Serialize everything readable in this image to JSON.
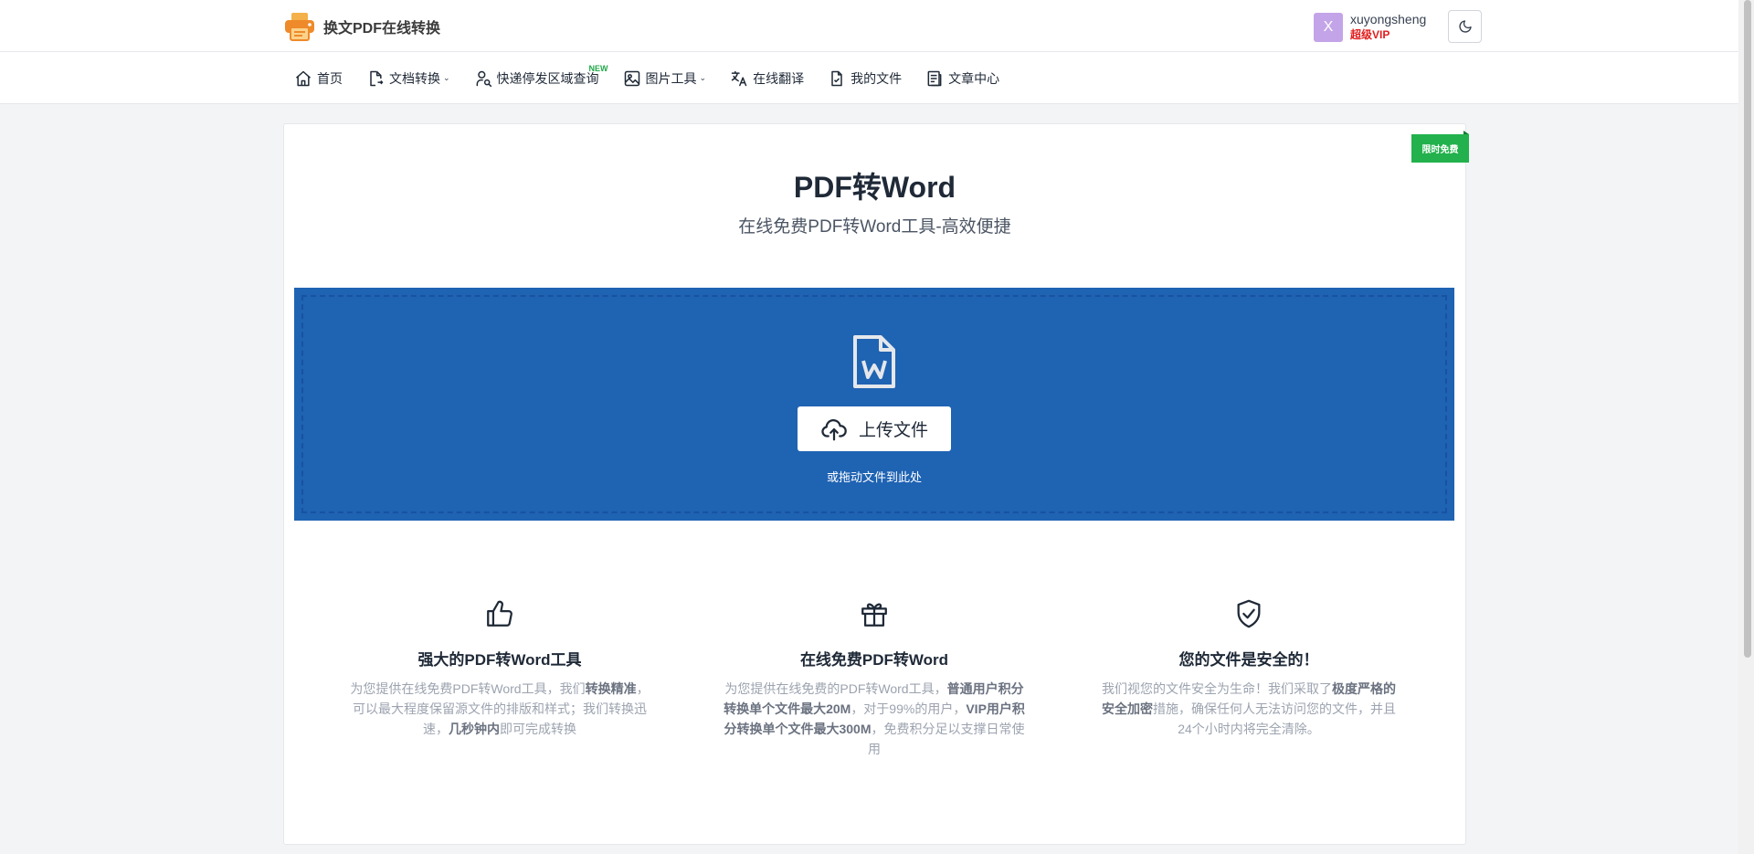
{
  "header": {
    "logo_text": "换文PDF在线转换",
    "user": {
      "avatar_letter": "X",
      "name": "xuyongsheng",
      "vip": "超级VIP"
    }
  },
  "nav": {
    "items": [
      {
        "label": "首页",
        "icon": "home-icon",
        "dropdown": false
      },
      {
        "label": "文档转换",
        "icon": "document-convert-icon",
        "dropdown": true
      },
      {
        "label": "快递停发区域查询",
        "icon": "user-search-icon",
        "dropdown": false,
        "badge": "NEW"
      },
      {
        "label": "图片工具",
        "icon": "image-icon",
        "dropdown": true
      },
      {
        "label": "在线翻译",
        "icon": "translate-icon",
        "dropdown": false
      },
      {
        "label": "我的文件",
        "icon": "file-check-icon",
        "dropdown": false
      },
      {
        "label": "文章中心",
        "icon": "article-icon",
        "dropdown": false
      }
    ]
  },
  "main": {
    "ribbon": "限时免费",
    "title": "PDF转Word",
    "subtitle": "在线免费PDF转Word工具-高效便捷",
    "upload_label": "上传文件",
    "drop_hint": "或拖动文件到此处"
  },
  "features": [
    {
      "icon": "thumbs-up-icon",
      "title": "强大的PDF转Word工具",
      "desc_parts": [
        {
          "text": "为您提供在线免费PDF转Word工具，我们",
          "bold": false
        },
        {
          "text": "转换精准",
          "bold": true
        },
        {
          "text": "，可以最大程度保留源文件的排版和样式；我们转换迅速，",
          "bold": false
        },
        {
          "text": "几秒钟内",
          "bold": true
        },
        {
          "text": "即可完成转换",
          "bold": false
        }
      ]
    },
    {
      "icon": "gift-icon",
      "title": "在线免费PDF转Word",
      "desc_parts": [
        {
          "text": "为您提供在线免费的PDF转Word工具，",
          "bold": false
        },
        {
          "text": "普通用户积分转换单个文件最大20M",
          "bold": true
        },
        {
          "text": "，对于99%的用户，",
          "bold": false
        },
        {
          "text": "VIP用户积分转换单个文件最大300M",
          "bold": true
        },
        {
          "text": "，免费积分足以支撑日常使用",
          "bold": false
        }
      ]
    },
    {
      "icon": "shield-check-icon",
      "title": "您的文件是安全的！",
      "desc_parts": [
        {
          "text": "我们视您的文件安全为生命！我们采取了",
          "bold": false
        },
        {
          "text": "极度严格的安全加密",
          "bold": true
        },
        {
          "text": "措施，确保任何人无法访问您的文件，并且24个小时内将完全清除。",
          "bold": false
        }
      ]
    }
  ],
  "colors": {
    "dropzone": "#1f63b3",
    "ribbon": "#22b14c",
    "vip": "#e11d1d",
    "avatar": "#c4a4e8"
  }
}
